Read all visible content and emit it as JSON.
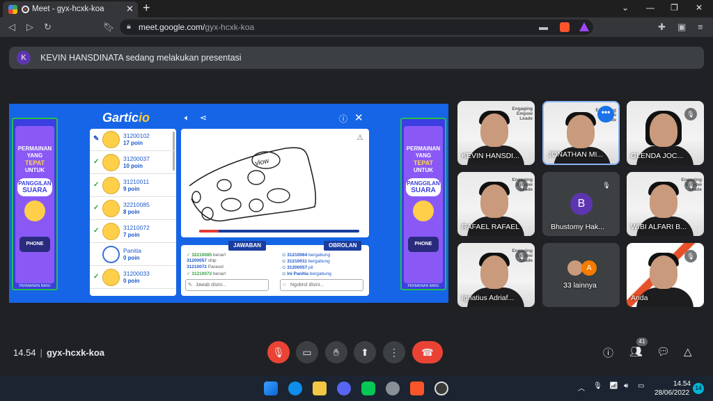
{
  "browser": {
    "tab_title": "Meet - gyx-hcxk-koa",
    "tab_close": "✕",
    "new_tab": "+",
    "url_domain": "meet.google.com/",
    "url_path": "gyx-hcxk-koa"
  },
  "presentation_banner": {
    "avatar_letter": "K",
    "text": "KEVIN HANSDINATA sedang melakukan presentasi"
  },
  "game": {
    "logo_main": "Gartic",
    "logo_suffix": "io",
    "ad": {
      "line1": "PERMAINAN",
      "line2": "YANG",
      "line3": "TEPAT",
      "line4": "UNTUK",
      "pill_line1": "PANGGILAN",
      "pill_line2": "SUARA",
      "logo": "PHONE",
      "footer": "PERMAINAN BARU"
    },
    "players": [
      {
        "name": "31200102",
        "points": "17 poin",
        "status": "drawing"
      },
      {
        "name": "31200037",
        "points": "10 poin",
        "status": "correct"
      },
      {
        "name": "31210011",
        "points": "9 poin",
        "status": "correct"
      },
      {
        "name": "32210085",
        "points": "8 poin",
        "status": "correct"
      },
      {
        "name": "31210072",
        "points": "7 poin",
        "status": "correct"
      },
      {
        "name": "Panitia",
        "points": "0 poin",
        "status": "none"
      },
      {
        "name": "31200033",
        "points": "0 poin",
        "status": "correct"
      }
    ],
    "canvas_word": "vlow",
    "answers_header": "JAWABAN",
    "chat_header": "OBROLAN",
    "answers": [
      {
        "user": "32210085",
        "text": "benar!",
        "ok": true
      },
      {
        "user": "31200057",
        "text": "ship",
        "ok": false
      },
      {
        "user": "31210072",
        "text": "Parasol",
        "ok": false
      },
      {
        "user": "31210072",
        "text": "benar!",
        "ok": true
      }
    ],
    "chat": [
      {
        "user": "31210064",
        "text": "bergabung"
      },
      {
        "user": "31210011",
        "text": "bergabung"
      },
      {
        "user": "31200057",
        "text": "pil"
      },
      {
        "user": "Ini Panitia",
        "text": "bergabung"
      }
    ],
    "answer_placeholder": "Jawab disini...",
    "chat_placeholder": "Ngobrol disini...",
    "progress": 0.12
  },
  "participants": [
    {
      "name": "KEVIN HANSDI...",
      "type": "camera"
    },
    {
      "name": "JONATHAN MI...",
      "type": "camera"
    },
    {
      "name": "GLENDA JOC...",
      "type": "camera"
    },
    {
      "name": "RAFAEL RAFAEL",
      "type": "camera"
    },
    {
      "name": "Bhustomy Hak...",
      "type": "avatar",
      "letter": "B"
    },
    {
      "name": "WIBI ALFARI B...",
      "type": "camera"
    },
    {
      "name": "Ignatius Adriaf...",
      "type": "camera"
    },
    {
      "name": "33 lainnya",
      "type": "others",
      "letter": "A"
    },
    {
      "name": "Anda",
      "type": "camera"
    }
  ],
  "tile_brand": [
    "Engaging",
    "Empow",
    "Leade"
  ],
  "meeting": {
    "time": "14.54",
    "code": "gyx-hcxk-koa",
    "people_count": "41"
  },
  "taskbar": {
    "time": "14.54",
    "date": "28/06/2022",
    "notifications": "14"
  },
  "colors": {
    "accent": "#1a73e8",
    "end_call": "#ea4335",
    "stage_bg": "#1565e6"
  }
}
